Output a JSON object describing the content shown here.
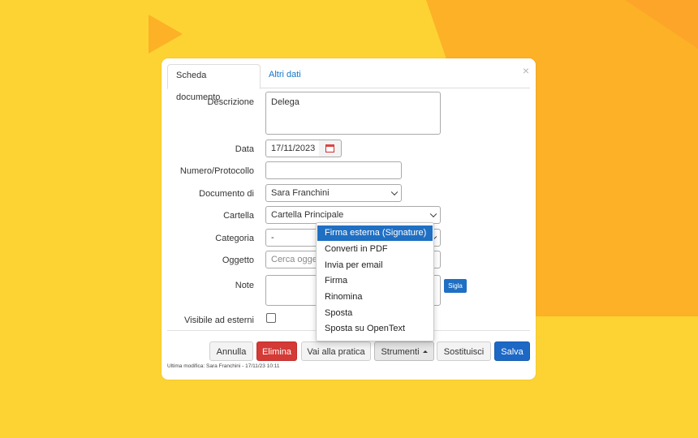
{
  "colors": {
    "background_yellow": "#fdd333",
    "background_orange": "#fcb127",
    "accent_blue": "#1f6fc3",
    "danger_red": "#d43a36"
  },
  "tabs": [
    {
      "label": "Scheda documento",
      "active": true
    },
    {
      "label": "Altri dati",
      "active": false
    }
  ],
  "close_icon": "×",
  "form": {
    "descrizione": {
      "label": "Descrizione",
      "value": "Delega"
    },
    "data": {
      "label": "Data",
      "value": "17/11/2023",
      "icon": "calendar-icon"
    },
    "numero": {
      "label": "Numero/Protocollo",
      "value": ""
    },
    "documento_di": {
      "label": "Documento di",
      "value": "Sara Franchini"
    },
    "cartella": {
      "label": "Cartella",
      "value": "Cartella Principale"
    },
    "categoria": {
      "label": "Categoria",
      "value": "-"
    },
    "oggetto": {
      "label": "Oggetto",
      "placeholder": "Cerca oggetto"
    },
    "note": {
      "label": "Note",
      "value": "",
      "sigla_label": "Sigla"
    },
    "visibile": {
      "label": "Visibile ad esterni",
      "checked": false
    }
  },
  "buttons": {
    "annulla": "Annulla",
    "elimina": "Elimina",
    "vai_pratica": "Vai alla pratica",
    "strumenti": "Strumenti",
    "sostituisci": "Sostituisci",
    "salva": "Salva"
  },
  "footer": {
    "last_modified": "Ultima modifica: Sara Franchini - 17/11/23 10:11"
  },
  "strumenti_menu": [
    {
      "label": "Firma esterna (Signature)",
      "highlighted": true
    },
    {
      "label": "Converti in PDF",
      "highlighted": false
    },
    {
      "label": "Invia per email",
      "highlighted": false
    },
    {
      "label": "Firma",
      "highlighted": false
    },
    {
      "label": "Rinomina",
      "highlighted": false
    },
    {
      "label": "Sposta",
      "highlighted": false
    },
    {
      "label": "Sposta su OpenText",
      "highlighted": false
    }
  ]
}
